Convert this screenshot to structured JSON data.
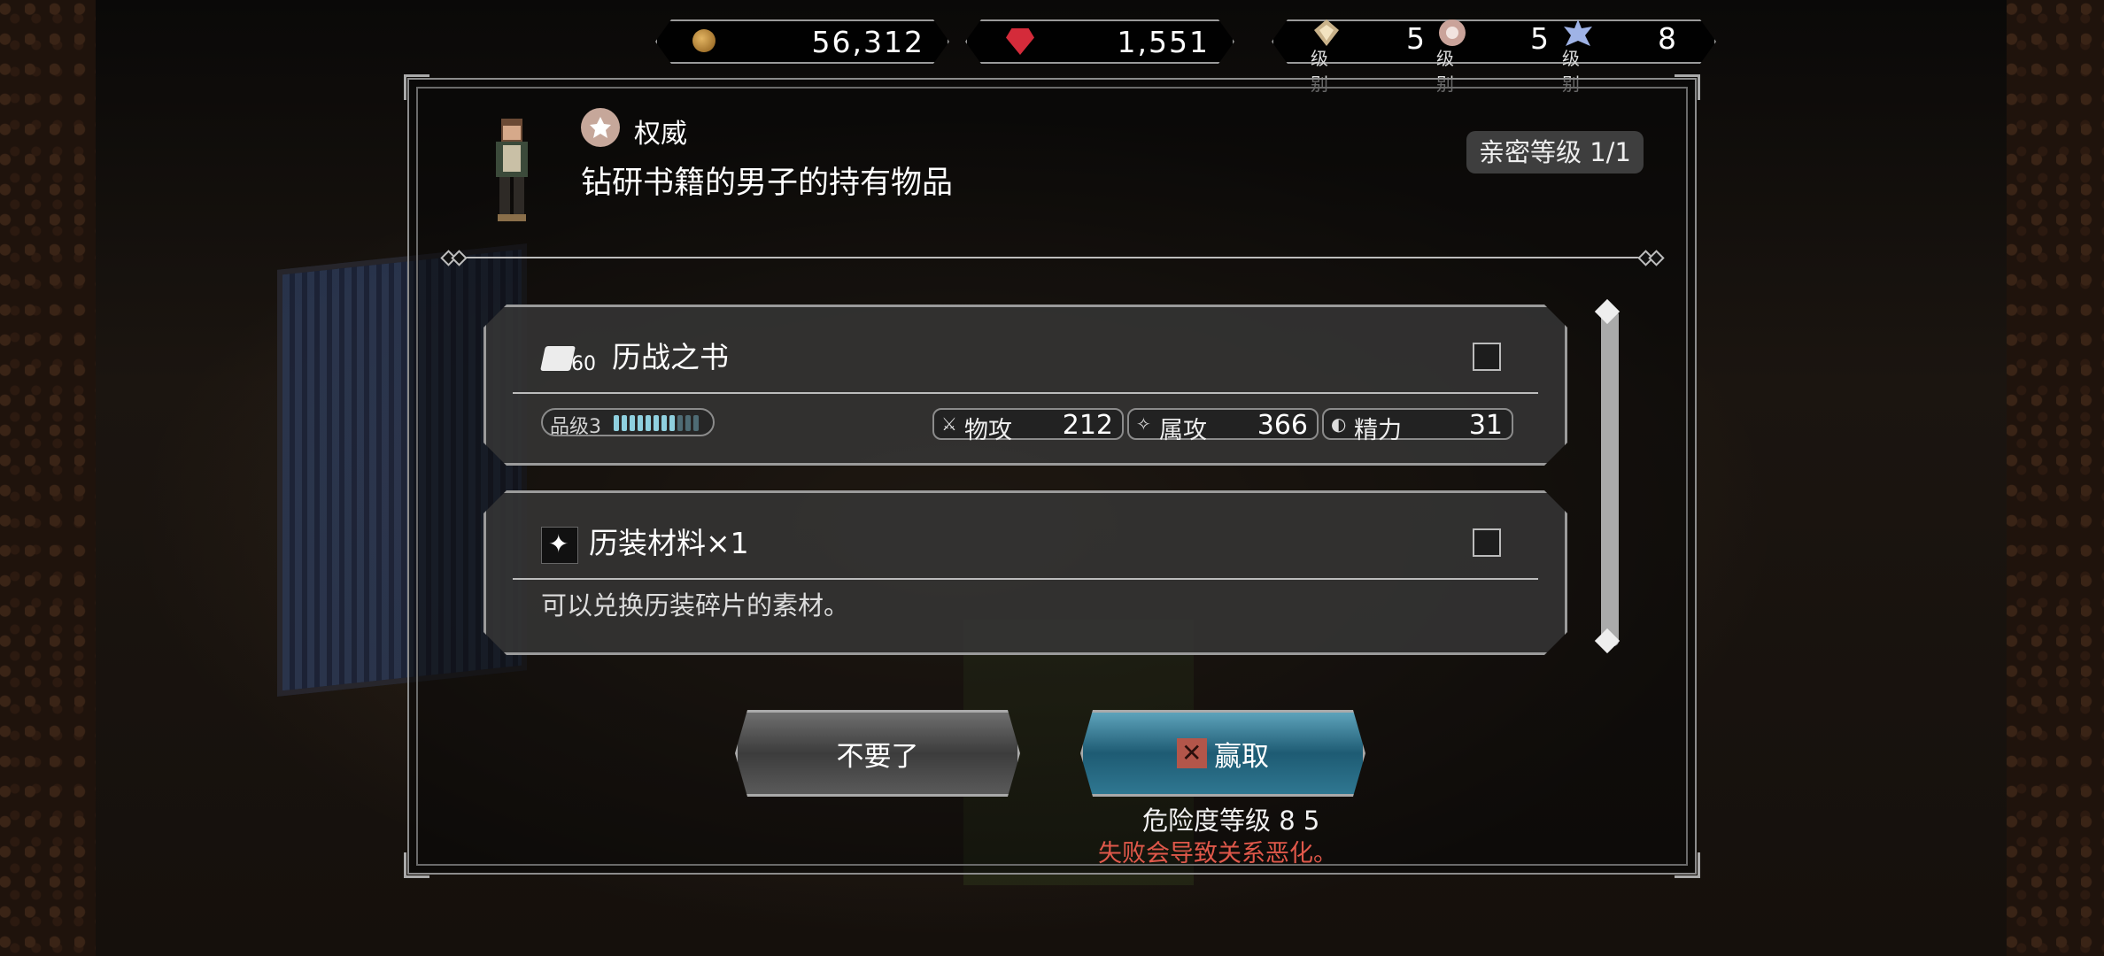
{
  "currency": {
    "gold": "56,312",
    "gems": "1,551"
  },
  "ranks": [
    {
      "label": "级别",
      "value": "5",
      "icon": "authority-rank-icon"
    },
    {
      "label": "级别",
      "value": "5",
      "icon": "fame-rank-icon"
    },
    {
      "label": "级别",
      "value": "8",
      "icon": "power-rank-icon"
    }
  ],
  "header": {
    "category": "权威",
    "title": "钻研书籍的男子的持有物品",
    "affinity": "亲密等级 1/1"
  },
  "items": [
    {
      "icon_badge": "60",
      "name": "历战之书",
      "grade_label": "品级3",
      "grade_filled": 8,
      "grade_total": 11,
      "stats": [
        {
          "label": "物攻",
          "value": "212"
        },
        {
          "label": "属攻",
          "value": "366"
        },
        {
          "label": "精力",
          "value": "31"
        }
      ]
    },
    {
      "name": "历装材料×1",
      "description": "可以兑换历装碎片的素材。"
    }
  ],
  "buttons": {
    "decline": "不要了",
    "steal": "赢取"
  },
  "danger_label": "危险度等级 8 5",
  "warning": "失败会导致关系恶化。",
  "colors": {
    "accent_steal": "#2f7791",
    "warning_red": "#e0584a",
    "grade_bar": "#8fd0df"
  }
}
